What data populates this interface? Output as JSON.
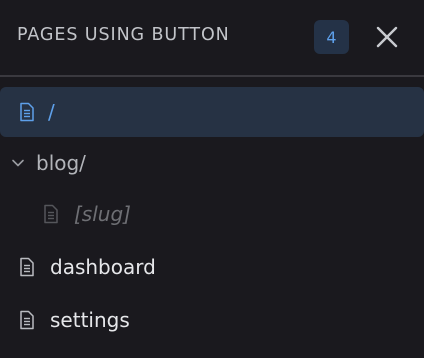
{
  "header": {
    "title": "PAGES USING BUTTON",
    "count": "4"
  },
  "tree": {
    "items": [
      {
        "label": "/",
        "icon": "file-icon",
        "selected": true
      },
      {
        "label": "blog/",
        "icon": "chevron-down-icon",
        "expanded": true
      },
      {
        "label": "[slug]",
        "icon": "file-icon",
        "muted": true
      },
      {
        "label": "dashboard",
        "icon": "file-icon"
      },
      {
        "label": "settings",
        "icon": "file-icon"
      }
    ]
  },
  "colors": {
    "background": "#1a191e",
    "selected_row": "#263244",
    "accent": "#5ea0ea",
    "badge_bg": "#243247"
  }
}
